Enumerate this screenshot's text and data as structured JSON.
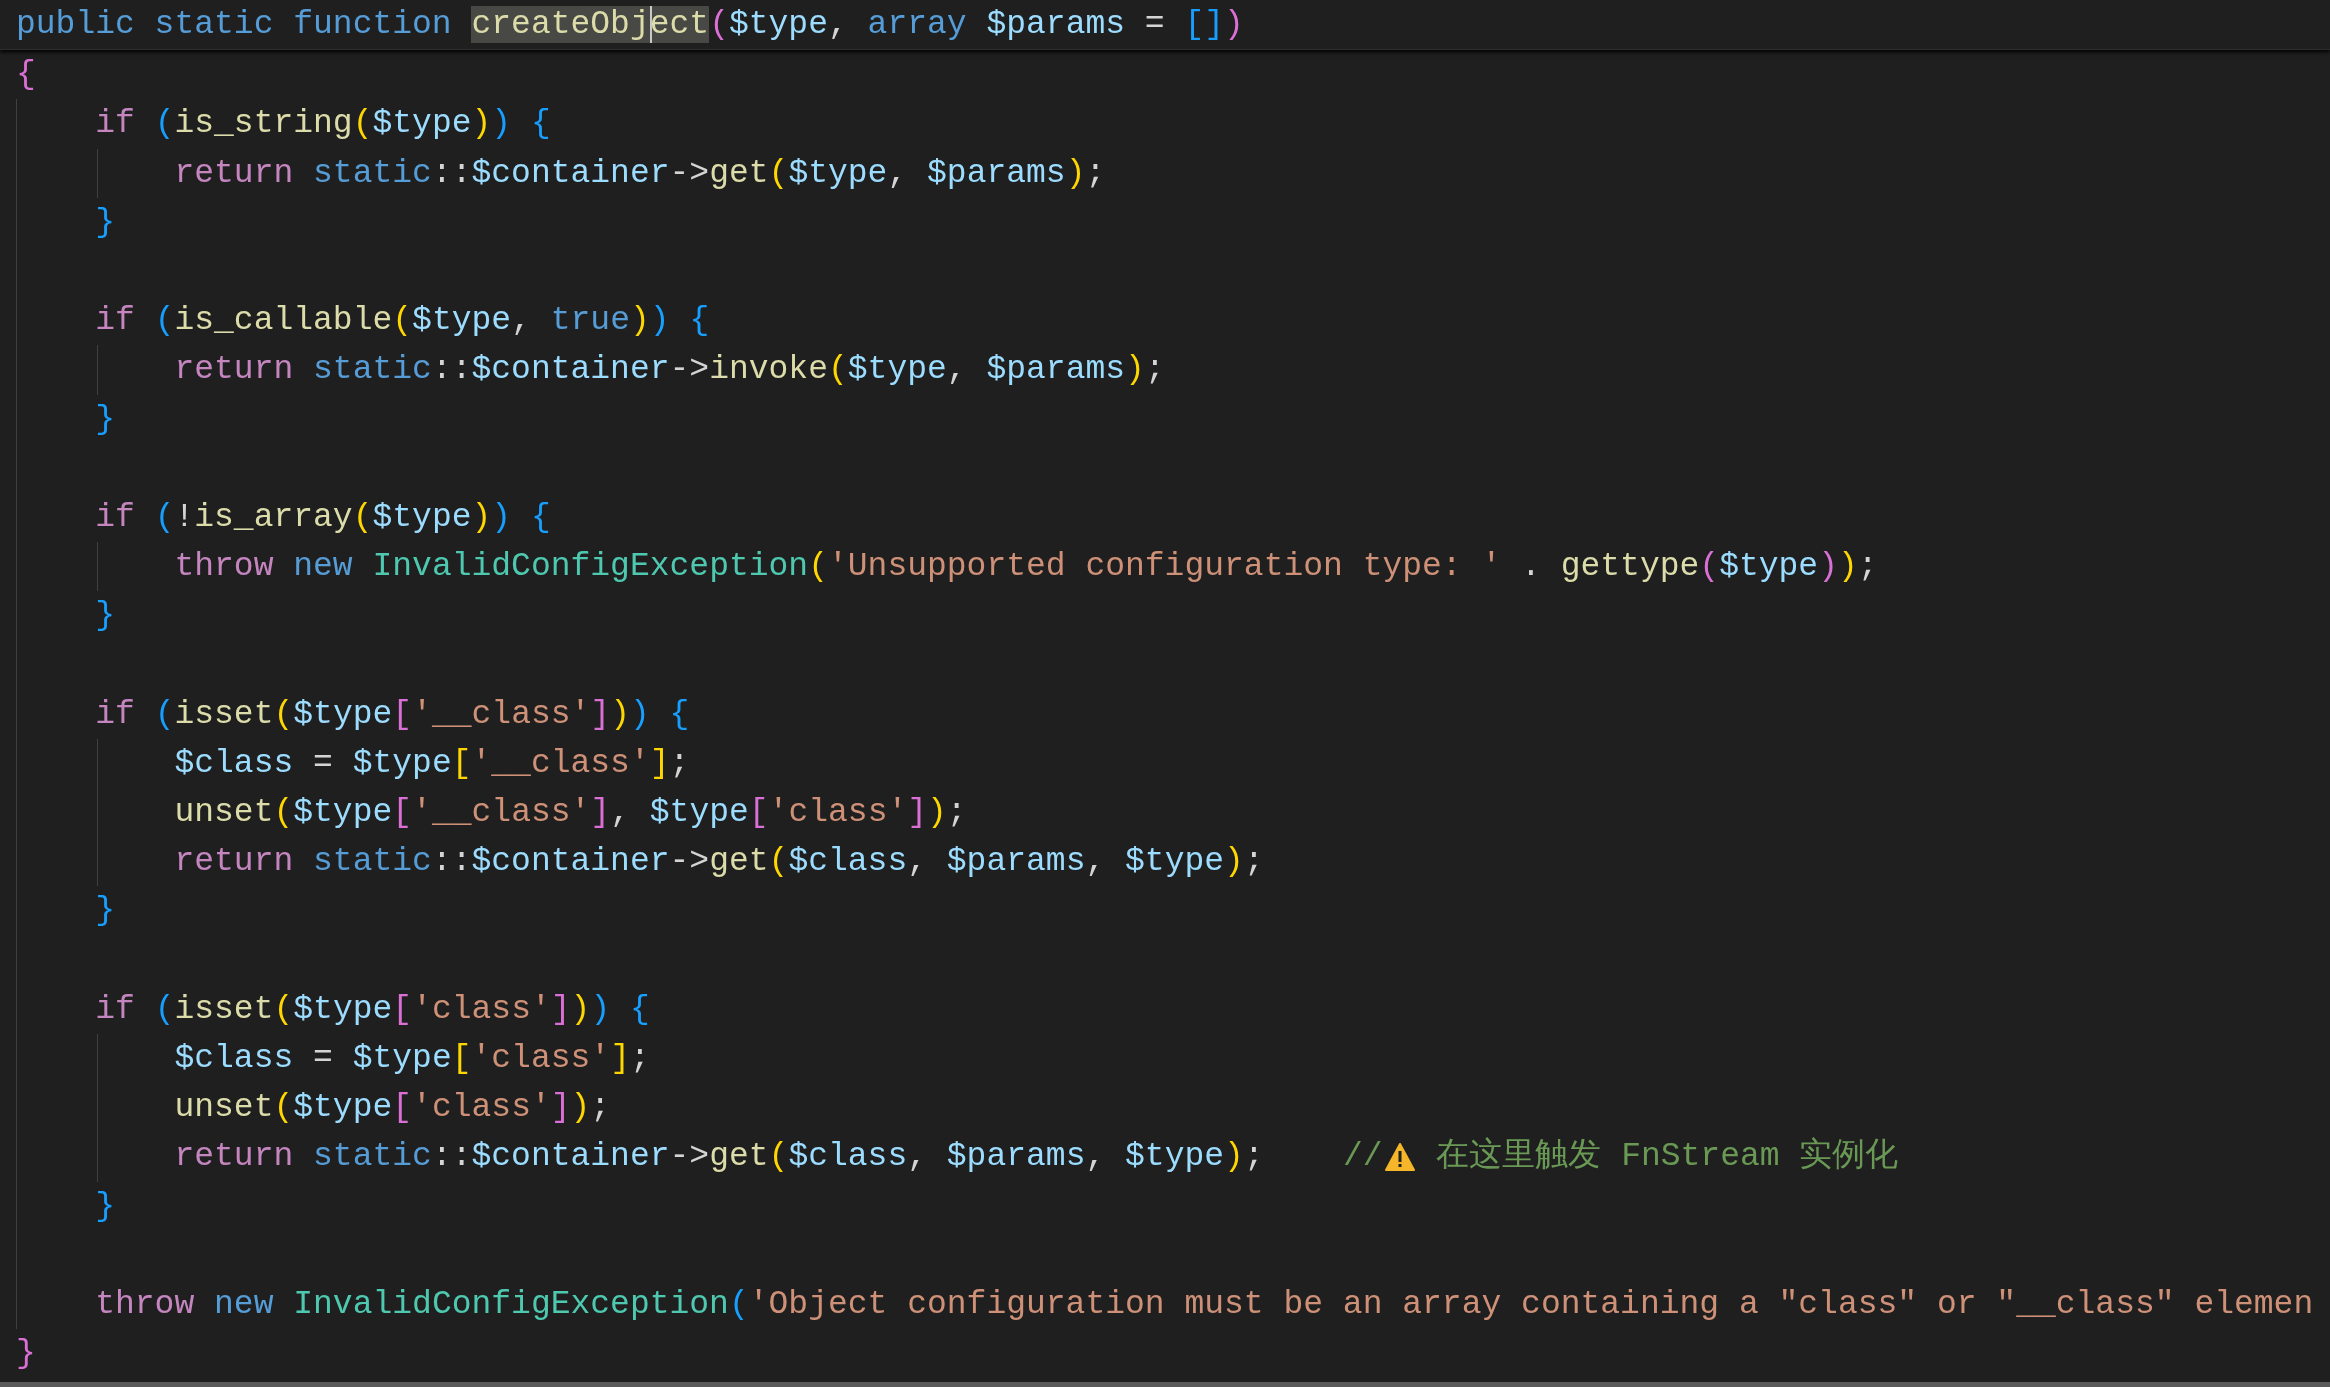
{
  "editor": {
    "lines": [
      {
        "kind": "code",
        "tokens": [
          {
            "kind": "kw",
            "text": "public static function "
          },
          {
            "kind": "fn",
            "text": "createObj",
            "highlighted": true,
            "cursor": false
          },
          {
            "kind": "fn",
            "text": "ect",
            "highlighted": true,
            "cursor": true
          },
          {
            "kind": "b2",
            "text": "("
          },
          {
            "kind": "var",
            "text": "$type"
          },
          {
            "kind": "op",
            "text": ","
          },
          {
            "kind": "kw",
            "text": " array"
          },
          {
            "kind": "var",
            "text": " $params"
          },
          {
            "kind": "op",
            "text": " ="
          },
          {
            "kind": "b3",
            "text": " []"
          },
          {
            "kind": "b2",
            "text": ")"
          }
        ]
      },
      {
        "kind": "code",
        "tokens": [
          {
            "kind": "b2",
            "text": "{"
          }
        ]
      },
      {
        "kind": "code",
        "tokens": [
          {
            "kind": "ctl",
            "text": "    if"
          },
          {
            "kind": "b3",
            "text": " ("
          },
          {
            "kind": "fn",
            "text": "is_string"
          },
          {
            "kind": "b1",
            "text": "("
          },
          {
            "kind": "var",
            "text": "$type"
          },
          {
            "kind": "b1",
            "text": ")"
          },
          {
            "kind": "b3",
            "text": ")"
          },
          {
            "kind": "b3",
            "text": " {"
          }
        ]
      },
      {
        "kind": "code",
        "tokens": [
          {
            "kind": "ctl",
            "text": "        return"
          },
          {
            "kind": "kw",
            "text": " static"
          },
          {
            "kind": "op",
            "text": "::"
          },
          {
            "kind": "var",
            "text": "$container"
          },
          {
            "kind": "op",
            "text": "->"
          },
          {
            "kind": "fn",
            "text": "get"
          },
          {
            "kind": "b1",
            "text": "("
          },
          {
            "kind": "var",
            "text": "$type"
          },
          {
            "kind": "op",
            "text": ","
          },
          {
            "kind": "var",
            "text": " $params"
          },
          {
            "kind": "b1",
            "text": ")"
          },
          {
            "kind": "op",
            "text": ";"
          }
        ]
      },
      {
        "kind": "code",
        "tokens": [
          {
            "kind": "b3",
            "text": "    }"
          }
        ]
      },
      {
        "kind": "blank"
      },
      {
        "kind": "code",
        "tokens": [
          {
            "kind": "ctl",
            "text": "    if"
          },
          {
            "kind": "b3",
            "text": " ("
          },
          {
            "kind": "fn",
            "text": "is_callable"
          },
          {
            "kind": "b1",
            "text": "("
          },
          {
            "kind": "var",
            "text": "$type"
          },
          {
            "kind": "op",
            "text": ","
          },
          {
            "kind": "kw",
            "text": " true"
          },
          {
            "kind": "b1",
            "text": ")"
          },
          {
            "kind": "b3",
            "text": ")"
          },
          {
            "kind": "b3",
            "text": " {"
          }
        ]
      },
      {
        "kind": "code",
        "tokens": [
          {
            "kind": "ctl",
            "text": "        return"
          },
          {
            "kind": "kw",
            "text": " static"
          },
          {
            "kind": "op",
            "text": "::"
          },
          {
            "kind": "var",
            "text": "$container"
          },
          {
            "kind": "op",
            "text": "->"
          },
          {
            "kind": "fn",
            "text": "invoke"
          },
          {
            "kind": "b1",
            "text": "("
          },
          {
            "kind": "var",
            "text": "$type"
          },
          {
            "kind": "op",
            "text": ","
          },
          {
            "kind": "var",
            "text": " $params"
          },
          {
            "kind": "b1",
            "text": ")"
          },
          {
            "kind": "op",
            "text": ";"
          }
        ]
      },
      {
        "kind": "code",
        "tokens": [
          {
            "kind": "b3",
            "text": "    }"
          }
        ]
      },
      {
        "kind": "blank"
      },
      {
        "kind": "code",
        "tokens": [
          {
            "kind": "ctl",
            "text": "    if"
          },
          {
            "kind": "b3",
            "text": " ("
          },
          {
            "kind": "op",
            "text": "!"
          },
          {
            "kind": "fn",
            "text": "is_array"
          },
          {
            "kind": "b1",
            "text": "("
          },
          {
            "kind": "var",
            "text": "$type"
          },
          {
            "kind": "b1",
            "text": ")"
          },
          {
            "kind": "b3",
            "text": ")"
          },
          {
            "kind": "b3",
            "text": " {"
          }
        ]
      },
      {
        "kind": "code",
        "tokens": [
          {
            "kind": "ctl",
            "text": "        throw"
          },
          {
            "kind": "kw",
            "text": " new"
          },
          {
            "kind": "cls",
            "text": " InvalidConfigException"
          },
          {
            "kind": "b1",
            "text": "("
          },
          {
            "kind": "str",
            "text": "'Unsupported configuration type: '"
          },
          {
            "kind": "op",
            "text": " ."
          },
          {
            "kind": "fn",
            "text": " gettype"
          },
          {
            "kind": "b2",
            "text": "("
          },
          {
            "kind": "var",
            "text": "$type"
          },
          {
            "kind": "b2",
            "text": ")"
          },
          {
            "kind": "b1",
            "text": ")"
          },
          {
            "kind": "op",
            "text": ";"
          }
        ]
      },
      {
        "kind": "code",
        "tokens": [
          {
            "kind": "b3",
            "text": "    }"
          }
        ]
      },
      {
        "kind": "blank"
      },
      {
        "kind": "code",
        "tokens": [
          {
            "kind": "ctl",
            "text": "    if"
          },
          {
            "kind": "b3",
            "text": " ("
          },
          {
            "kind": "fn",
            "text": "isset"
          },
          {
            "kind": "b1",
            "text": "("
          },
          {
            "kind": "var",
            "text": "$type"
          },
          {
            "kind": "b2",
            "text": "["
          },
          {
            "kind": "str",
            "text": "'__class'"
          },
          {
            "kind": "b2",
            "text": "]"
          },
          {
            "kind": "b1",
            "text": ")"
          },
          {
            "kind": "b3",
            "text": ")"
          },
          {
            "kind": "b3",
            "text": " {"
          }
        ]
      },
      {
        "kind": "code",
        "tokens": [
          {
            "kind": "var",
            "text": "        $class"
          },
          {
            "kind": "op",
            "text": " ="
          },
          {
            "kind": "var",
            "text": " $type"
          },
          {
            "kind": "b1",
            "text": "["
          },
          {
            "kind": "str",
            "text": "'__class'"
          },
          {
            "kind": "b1",
            "text": "]"
          },
          {
            "kind": "op",
            "text": ";"
          }
        ]
      },
      {
        "kind": "code",
        "tokens": [
          {
            "kind": "fn",
            "text": "        unset"
          },
          {
            "kind": "b1",
            "text": "("
          },
          {
            "kind": "var",
            "text": "$type"
          },
          {
            "kind": "b2",
            "text": "["
          },
          {
            "kind": "str",
            "text": "'__class'"
          },
          {
            "kind": "b2",
            "text": "]"
          },
          {
            "kind": "op",
            "text": ","
          },
          {
            "kind": "var",
            "text": " $type"
          },
          {
            "kind": "b2",
            "text": "["
          },
          {
            "kind": "str",
            "text": "'class'"
          },
          {
            "kind": "b2",
            "text": "]"
          },
          {
            "kind": "b1",
            "text": ")"
          },
          {
            "kind": "op",
            "text": ";"
          }
        ]
      },
      {
        "kind": "code",
        "tokens": [
          {
            "kind": "ctl",
            "text": "        return"
          },
          {
            "kind": "kw",
            "text": " static"
          },
          {
            "kind": "op",
            "text": "::"
          },
          {
            "kind": "var",
            "text": "$container"
          },
          {
            "kind": "op",
            "text": "->"
          },
          {
            "kind": "fn",
            "text": "get"
          },
          {
            "kind": "b1",
            "text": "("
          },
          {
            "kind": "var",
            "text": "$class"
          },
          {
            "kind": "op",
            "text": ","
          },
          {
            "kind": "var",
            "text": " $params"
          },
          {
            "kind": "op",
            "text": ","
          },
          {
            "kind": "var",
            "text": " $type"
          },
          {
            "kind": "b1",
            "text": ")"
          },
          {
            "kind": "op",
            "text": ";"
          }
        ]
      },
      {
        "kind": "code",
        "tokens": [
          {
            "kind": "b3",
            "text": "    }"
          }
        ]
      },
      {
        "kind": "blank"
      },
      {
        "kind": "code",
        "tokens": [
          {
            "kind": "ctl",
            "text": "    if"
          },
          {
            "kind": "b3",
            "text": " ("
          },
          {
            "kind": "fn",
            "text": "isset"
          },
          {
            "kind": "b1",
            "text": "("
          },
          {
            "kind": "var",
            "text": "$type"
          },
          {
            "kind": "b2",
            "text": "["
          },
          {
            "kind": "str",
            "text": "'class'"
          },
          {
            "kind": "b2",
            "text": "]"
          },
          {
            "kind": "b1",
            "text": ")"
          },
          {
            "kind": "b3",
            "text": ")"
          },
          {
            "kind": "b3",
            "text": " {"
          }
        ]
      },
      {
        "kind": "code",
        "tokens": [
          {
            "kind": "var",
            "text": "        $class"
          },
          {
            "kind": "op",
            "text": " ="
          },
          {
            "kind": "var",
            "text": " $type"
          },
          {
            "kind": "b1",
            "text": "["
          },
          {
            "kind": "str",
            "text": "'class'"
          },
          {
            "kind": "b1",
            "text": "]"
          },
          {
            "kind": "op",
            "text": ";"
          }
        ]
      },
      {
        "kind": "code",
        "tokens": [
          {
            "kind": "fn",
            "text": "        unset"
          },
          {
            "kind": "b1",
            "text": "("
          },
          {
            "kind": "var",
            "text": "$type"
          },
          {
            "kind": "b2",
            "text": "["
          },
          {
            "kind": "str",
            "text": "'class'"
          },
          {
            "kind": "b2",
            "text": "]"
          },
          {
            "kind": "b1",
            "text": ")"
          },
          {
            "kind": "op",
            "text": ";"
          }
        ]
      },
      {
        "kind": "code",
        "tokens": [
          {
            "kind": "ctl",
            "text": "        return"
          },
          {
            "kind": "kw",
            "text": " static"
          },
          {
            "kind": "op",
            "text": "::"
          },
          {
            "kind": "var",
            "text": "$container"
          },
          {
            "kind": "op",
            "text": "->"
          },
          {
            "kind": "fn",
            "text": "get"
          },
          {
            "kind": "b1",
            "text": "("
          },
          {
            "kind": "var",
            "text": "$class"
          },
          {
            "kind": "op",
            "text": ","
          },
          {
            "kind": "var",
            "text": " $params"
          },
          {
            "kind": "op",
            "text": ","
          },
          {
            "kind": "var",
            "text": " $type"
          },
          {
            "kind": "b1",
            "text": ")"
          },
          {
            "kind": "op",
            "text": ";"
          },
          {
            "kind": "cmt",
            "text": "    //"
          },
          {
            "kind": "icon"
          },
          {
            "kind": "cmt",
            "text": " 在这里触发 FnStream 实例化"
          }
        ]
      },
      {
        "kind": "code",
        "tokens": [
          {
            "kind": "b3",
            "text": "    }"
          }
        ]
      },
      {
        "kind": "blank"
      },
      {
        "kind": "code",
        "tokens": [
          {
            "kind": "ctl",
            "text": "    throw"
          },
          {
            "kind": "kw",
            "text": " new"
          },
          {
            "kind": "cls",
            "text": " InvalidConfigException"
          },
          {
            "kind": "b3",
            "text": "("
          },
          {
            "kind": "str",
            "text": "'Object configuration must be an array containing a \"class\" or \"__class\" elemen"
          }
        ]
      },
      {
        "kind": "code",
        "tokens": [
          {
            "kind": "b2",
            "text": "}"
          }
        ]
      }
    ]
  }
}
